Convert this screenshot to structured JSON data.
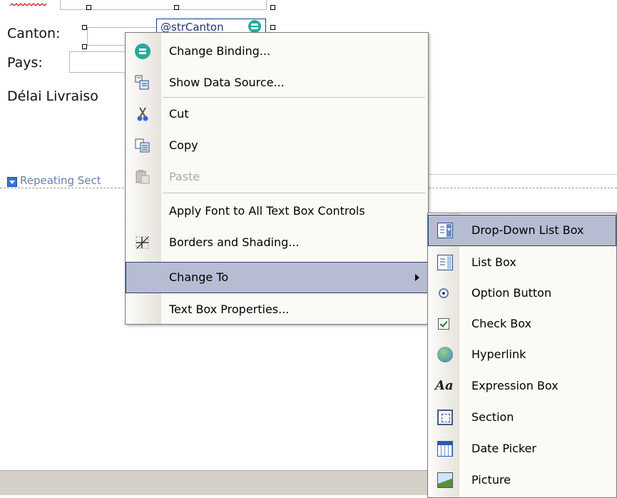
{
  "form": {
    "labels": {
      "canton": "Canton:",
      "pays": "Pays:",
      "delai": "Délai Livraiso"
    },
    "binding_field": "@strCanton",
    "repeating_section": "Repeating Sect"
  },
  "context_menu": {
    "items": [
      {
        "id": "change-binding",
        "label": "Change Binding...",
        "icon": "binding-icon",
        "disabled": false
      },
      {
        "id": "show-data-source",
        "label": "Show Data Source...",
        "icon": "data-source-icon",
        "disabled": false
      },
      {
        "id": "cut",
        "label": "Cut",
        "icon": "scissors-icon",
        "disabled": false
      },
      {
        "id": "copy",
        "label": "Copy",
        "icon": "copy-icon",
        "disabled": false
      },
      {
        "id": "paste",
        "label": "Paste",
        "icon": "paste-icon",
        "disabled": true
      },
      {
        "id": "apply-font",
        "label": "Apply Font to All Text Box Controls",
        "icon": "",
        "disabled": false
      },
      {
        "id": "borders-shading",
        "label": "Borders and Shading...",
        "icon": "borders-icon",
        "disabled": false
      },
      {
        "id": "change-to",
        "label": "Change To",
        "icon": "",
        "disabled": false,
        "selected": true,
        "submenu": true
      },
      {
        "id": "text-box-properties",
        "label": "Text Box Properties...",
        "icon": "",
        "disabled": false
      }
    ]
  },
  "submenu": {
    "items": [
      {
        "id": "drop-down-list-box",
        "label": "Drop-Down List Box",
        "icon": "drop-down-list-icon",
        "selected": true
      },
      {
        "id": "list-box",
        "label": "List Box",
        "icon": "list-box-icon"
      },
      {
        "id": "option-button",
        "label": "Option Button",
        "icon": "option-button-icon"
      },
      {
        "id": "check-box",
        "label": "Check Box",
        "icon": "check-box-icon"
      },
      {
        "id": "hyperlink",
        "label": "Hyperlink",
        "icon": "hyperlink-icon"
      },
      {
        "id": "expression-box",
        "label": "Expression Box",
        "icon": "expression-box-icon"
      },
      {
        "id": "section",
        "label": "Section",
        "icon": "section-icon"
      },
      {
        "id": "date-picker",
        "label": "Date Picker",
        "icon": "date-picker-icon"
      },
      {
        "id": "picture",
        "label": "Picture",
        "icon": "picture-icon"
      }
    ]
  },
  "colors": {
    "selection": "#b6bdd2",
    "selection_border": "#31456a",
    "menu_bg": "#fbfaf7",
    "disabled_text": "#a9a9a9"
  }
}
